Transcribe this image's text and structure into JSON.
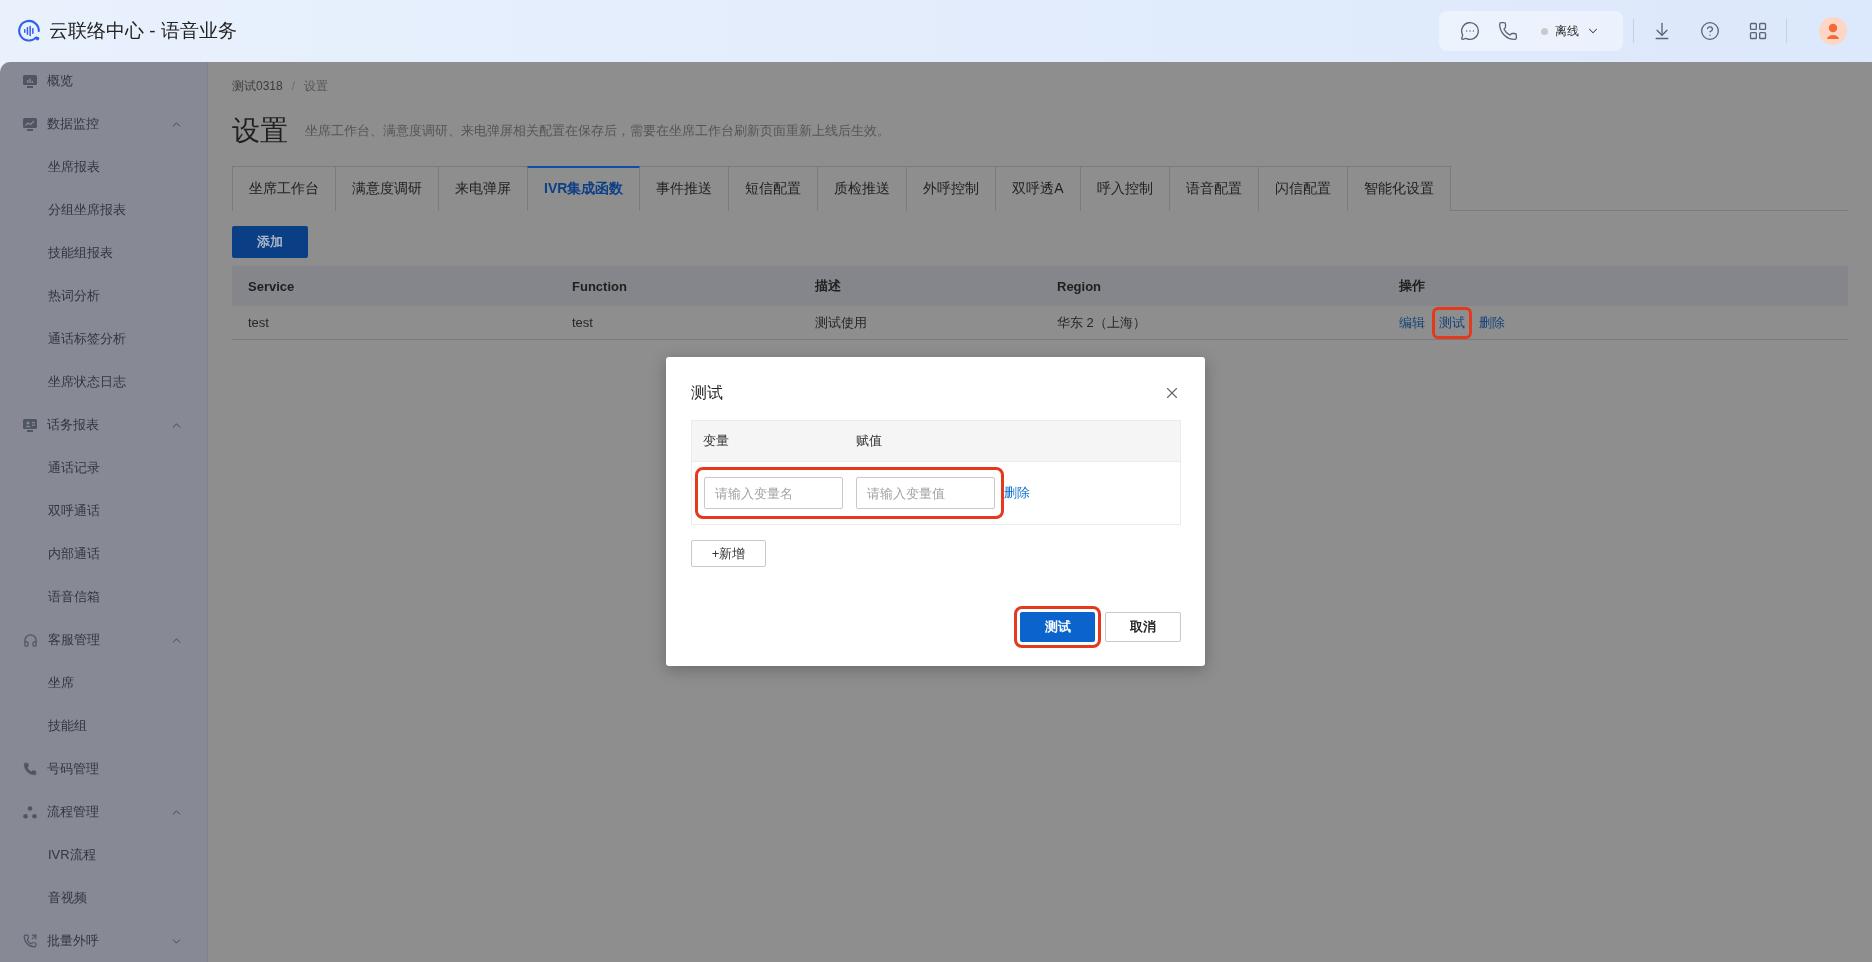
{
  "header": {
    "title": "云联络中心 - 语音业务",
    "status": {
      "label": "离线",
      "online": false
    }
  },
  "sidebar": {
    "items": [
      {
        "kind": "link",
        "label": "概览"
      },
      {
        "kind": "group",
        "label": "数据监控",
        "expanded": true,
        "children": [
          {
            "label": "坐席报表"
          },
          {
            "label": "分组坐席报表"
          },
          {
            "label": "技能组报表"
          },
          {
            "label": "热词分析"
          },
          {
            "label": "通话标签分析"
          },
          {
            "label": "坐席状态日志"
          }
        ]
      },
      {
        "kind": "group",
        "label": "话务报表",
        "expanded": true,
        "children": [
          {
            "label": "通话记录"
          },
          {
            "label": "双呼通话"
          },
          {
            "label": "内部通话"
          },
          {
            "label": "语音信箱"
          }
        ]
      },
      {
        "kind": "group",
        "label": "客服管理",
        "expanded": true,
        "children": [
          {
            "label": "坐席"
          },
          {
            "label": "技能组"
          }
        ]
      },
      {
        "kind": "link",
        "label": "号码管理"
      },
      {
        "kind": "group",
        "label": "流程管理",
        "expanded": true,
        "children": [
          {
            "label": "IVR流程"
          },
          {
            "label": "音视频"
          }
        ]
      },
      {
        "kind": "group",
        "label": "批量外呼",
        "expanded": false
      }
    ]
  },
  "breadcrumb": {
    "items": [
      "测试0318",
      "设置"
    ],
    "separator": "/"
  },
  "page": {
    "title": "设置",
    "description": "坐席工作台、满意度调研、来电弹屏相关配置在保存后，需要在坐席工作台刷新页面重新上线后生效。"
  },
  "tabs": [
    {
      "label": "坐席工作台",
      "selected": false
    },
    {
      "label": "满意度调研",
      "selected": false
    },
    {
      "label": "来电弹屏",
      "selected": false
    },
    {
      "label": "IVR集成函数",
      "selected": true
    },
    {
      "label": "事件推送",
      "selected": false
    },
    {
      "label": "短信配置",
      "selected": false
    },
    {
      "label": "质检推送",
      "selected": false
    },
    {
      "label": "外呼控制",
      "selected": false
    },
    {
      "label": "双呼透A",
      "selected": false
    },
    {
      "label": "呼入控制",
      "selected": false
    },
    {
      "label": "语音配置",
      "selected": false
    },
    {
      "label": "闪信配置",
      "selected": false
    },
    {
      "label": "智能化设置",
      "selected": false
    }
  ],
  "add_button": "添加",
  "table": {
    "columns": [
      "Service",
      "Function",
      "描述",
      "Region",
      "操作"
    ],
    "rows": [
      {
        "cells": [
          "test",
          "test",
          "测试使用",
          "华东 2（上海）"
        ],
        "actions": [
          {
            "label": "编辑",
            "highlighted": false
          },
          {
            "label": "测试",
            "highlighted": true
          },
          {
            "label": "删除",
            "highlighted": false
          }
        ]
      }
    ]
  },
  "dialog": {
    "title": "测试",
    "columns": [
      "变量",
      "赋值"
    ],
    "rows": [
      {
        "name": {
          "placeholder": "请输入变量名"
        },
        "value": {
          "placeholder": "请输入变量值"
        },
        "delete": "删除",
        "highlighted": true
      }
    ],
    "add_button": "+新增",
    "buttons": [
      {
        "label": "测试",
        "kind": "primary",
        "highlighted": true
      },
      {
        "label": "取消",
        "kind": "default",
        "highlighted": false
      }
    ]
  }
}
